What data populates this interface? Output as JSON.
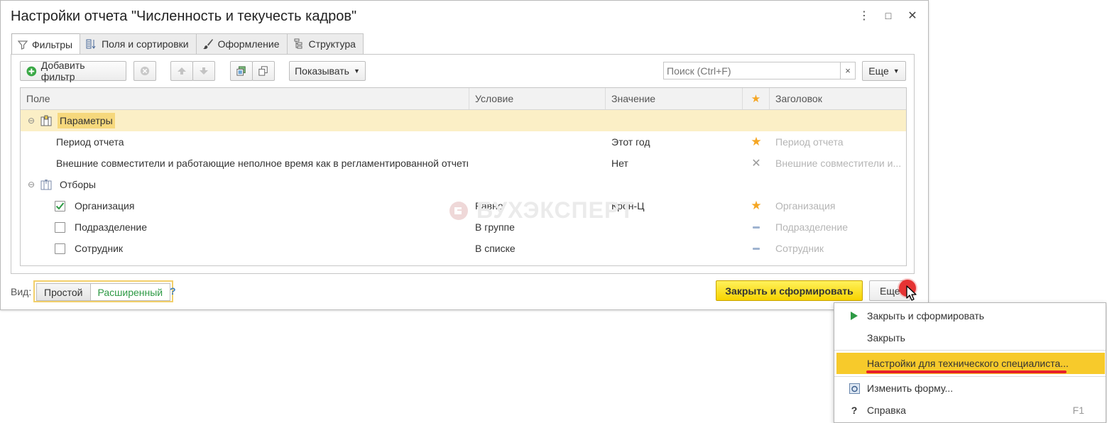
{
  "window": {
    "title": "Настройки отчета \"Численность и текучесть кадров\"",
    "controls": [
      "⋮",
      "□",
      "✕"
    ]
  },
  "tabs": [
    {
      "label": "Фильтры",
      "icon": "funnel-icon",
      "active": true
    },
    {
      "label": "Поля и сортировки",
      "icon": "fields-icon",
      "active": false
    },
    {
      "label": "Оформление",
      "icon": "brush-icon",
      "active": false
    },
    {
      "label": "Структура",
      "icon": "structure-icon",
      "active": false
    }
  ],
  "toolbar": {
    "add_filter": "Добавить фильтр",
    "show": "Показывать",
    "search_placeholder": "Поиск (Ctrl+F)",
    "search_clear": "×",
    "more": "Еще"
  },
  "grid": {
    "columns": {
      "field": "Поле",
      "condition": "Условие",
      "value": "Значение",
      "star": "★",
      "caption": "Заголовок"
    },
    "groups": {
      "params": "Параметры",
      "filters": "Отборы"
    },
    "rows": [
      {
        "field": "Период отчета",
        "condition": "",
        "value": "Этот год",
        "mark": "star",
        "caption": "Период отчета"
      },
      {
        "field": "Внешние совместители и работающие неполное время как в регламентированной отчетн...",
        "condition": "",
        "value": "Нет",
        "mark": "cross",
        "caption": "Внешние совместители и..."
      },
      {
        "field": "Организация",
        "condition": "Равно",
        "value": "Крон-Ц",
        "mark": "star",
        "caption": "Организация",
        "checked": true
      },
      {
        "field": "Подразделение",
        "condition": "В группе",
        "value": "",
        "mark": "dash",
        "caption": "Подразделение",
        "checked": false
      },
      {
        "field": "Сотрудник",
        "condition": "В списке",
        "value": "",
        "mark": "dash",
        "caption": "Сотрудник",
        "checked": false
      }
    ]
  },
  "watermark": "БУХЭКСПЕРТ",
  "bottom": {
    "view_label": "Вид:",
    "simple": "Простой",
    "extended": "Расширенный",
    "help": "?",
    "close_and_build": "Закрыть и сформировать",
    "more": "Еще"
  },
  "menu": {
    "items": [
      {
        "label": "Закрыть и сформировать",
        "icon": "play-icon",
        "key": ""
      },
      {
        "label": "Закрыть",
        "icon": "",
        "key": ""
      },
      {
        "label": "Настройки для технического специалиста...",
        "icon": "",
        "key": "",
        "highlighted": true
      },
      {
        "label": "Изменить форму...",
        "icon": "form-settings-icon",
        "key": ""
      },
      {
        "label": "Справка",
        "icon": "question-icon",
        "key": "F1"
      }
    ]
  },
  "colors": {
    "accent_yellow": "#f7d300",
    "highlight_row": "#fbefc6",
    "star": "#f5a623",
    "green": "#2e9a45",
    "menu_highlight": "#f7ca2b"
  }
}
